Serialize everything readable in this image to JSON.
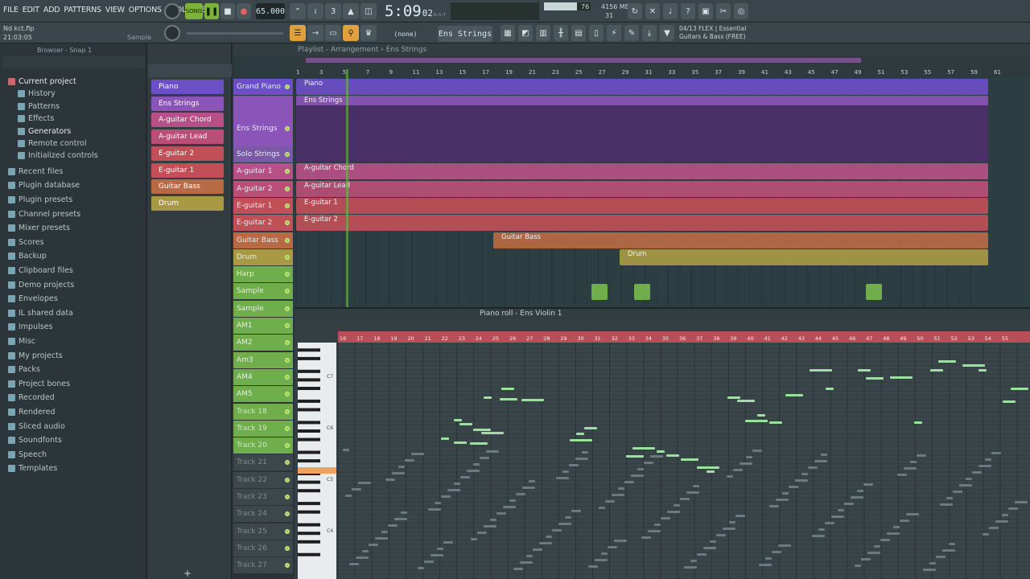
{
  "menu": [
    "FILE",
    "EDIT",
    "ADD",
    "PATTERNS",
    "VIEW",
    "OPTIONS",
    "TOOLS",
    "HELP"
  ],
  "transport": {
    "mode": "SONG",
    "tempo": "65.000",
    "time": "5:09",
    "time_sub": "02",
    "time_unit": "B:S:T",
    "memory": "4156 MB",
    "mem_sub": "31",
    "cpu": "76"
  },
  "hint": {
    "line1": "04/13  FLEX | Essential",
    "line2": "Guitars & Bass (FREE)"
  },
  "project": {
    "file": "Nd kct.flp",
    "clock": "21:03:05",
    "sample_label": "Sample"
  },
  "toolbar2": {
    "none_label": "(none)",
    "pattern": "Ens Strings"
  },
  "browser": {
    "title": "Browser - Snap 1",
    "items": [
      "Current project",
      "History",
      "Patterns",
      "Effects",
      "Generators",
      "Remote control",
      "Initialized controls",
      "Recent files",
      "Plugin database",
      "Plugin presets",
      "Channel presets",
      "Mixer presets",
      "Scores",
      "Backup",
      "Clipboard files",
      "Demo projects",
      "Envelopes",
      "IL shared data",
      "Impulses",
      "Misc",
      "My projects",
      "Packs",
      "Project bones",
      "Recorded",
      "Rendered",
      "Sliced audio",
      "Soundfonts",
      "Speech",
      "Templates"
    ]
  },
  "patterns": [
    {
      "label": "Piano",
      "color": "#6a4fc6"
    },
    {
      "label": "Ens Strings",
      "color": "#8a54b8"
    },
    {
      "label": "A-guitar Chord",
      "color": "#b84f87"
    },
    {
      "label": "A-guitar Lead",
      "color": "#b84f76"
    },
    {
      "label": "E-guitar 2",
      "color": "#c04f58"
    },
    {
      "label": "E-guitar 1",
      "color": "#c04f58"
    },
    {
      "label": "Guitar Bass",
      "color": "#b86a45"
    },
    {
      "label": "Drum",
      "color": "#a89a45"
    }
  ],
  "playlist": {
    "title": "Playlist - Arrangement",
    "crumb": "Ens Strings",
    "bars": [
      "1",
      "3",
      "5",
      "7",
      "9",
      "11",
      "13",
      "15",
      "17",
      "19",
      "21",
      "23",
      "25",
      "27",
      "29",
      "31",
      "33",
      "35",
      "37",
      "39",
      "41",
      "43",
      "45",
      "47",
      "49",
      "51",
      "53",
      "55",
      "57",
      "59",
      "61"
    ],
    "tracks": [
      {
        "label": "Grand Piano",
        "color": "#6a4fc6",
        "clip": "Piano"
      },
      {
        "label": "Ens Strings",
        "color": "#8a54b8",
        "clip": "Ens Strings"
      },
      {
        "label": "Solo Strings",
        "color": "#7a5aa6",
        "clip": ""
      },
      {
        "label": "A-guitar 1",
        "color": "#b84f87",
        "clip": "A-guitar Chord"
      },
      {
        "label": "A-guitar 2",
        "color": "#b84f76",
        "clip": "A-guitar Lead"
      },
      {
        "label": "E-guitar 1",
        "color": "#c04f58",
        "clip": "E-guitar 1"
      },
      {
        "label": "E-guitar 2",
        "color": "#c04f58",
        "clip": "E-guitar 2"
      },
      {
        "label": "Guitar Bass",
        "color": "#b86a45",
        "clip": "Guitar Bass"
      },
      {
        "label": "Drum",
        "color": "#a89a45",
        "clip": "Drum"
      },
      {
        "label": "Harp",
        "color": "#6fae4a",
        "clip": ""
      },
      {
        "label": "Sample",
        "color": "#6fae4a",
        "clip": ""
      },
      {
        "label": "Sample",
        "color": "#6fae4a",
        "clip": ""
      },
      {
        "label": "AM1",
        "color": "#6fae4a",
        "clip": ""
      },
      {
        "label": "AM2",
        "color": "#6fae4a",
        "clip": ""
      },
      {
        "label": "Am3",
        "color": "#6fae4a",
        "clip": ""
      },
      {
        "label": "AM4",
        "color": "#6fae4a",
        "clip": ""
      },
      {
        "label": "AM5",
        "color": "#6fae4a",
        "clip": ""
      },
      {
        "label": "Track 18",
        "color": "#6fae4a",
        "clip": ""
      },
      {
        "label": "Track 19",
        "color": "#6fae4a",
        "clip": ""
      },
      {
        "label": "Track 20",
        "color": "#6fae4a",
        "clip": ""
      },
      {
        "label": "Track 21",
        "color": "#3c474c",
        "clip": ""
      },
      {
        "label": "Track 22",
        "color": "#3c474c",
        "clip": ""
      },
      {
        "label": "Track 23",
        "color": "#3c474c",
        "clip": ""
      },
      {
        "label": "Track 24",
        "color": "#3c474c",
        "clip": ""
      },
      {
        "label": "Track 25",
        "color": "#3c474c",
        "clip": ""
      },
      {
        "label": "Track 26",
        "color": "#3c474c",
        "clip": ""
      },
      {
        "label": "Track 27",
        "color": "#3c474c",
        "clip": ""
      }
    ]
  },
  "pianoroll": {
    "title": "Piano roll - Ens Violin 1",
    "bars": [
      "16",
      "17",
      "18",
      "19",
      "20",
      "21",
      "22",
      "23",
      "24",
      "25",
      "26",
      "27",
      "28",
      "29",
      "30",
      "31",
      "32",
      "33",
      "34",
      "35",
      "36",
      "37",
      "38",
      "39",
      "40",
      "41",
      "42",
      "43",
      "44",
      "45",
      "46",
      "47",
      "48",
      "49",
      "50",
      "51",
      "52",
      "53",
      "54",
      "55"
    ],
    "octaves": [
      "C7",
      "C6",
      "C5",
      "C4"
    ],
    "note_color": "#9ee0a0"
  }
}
